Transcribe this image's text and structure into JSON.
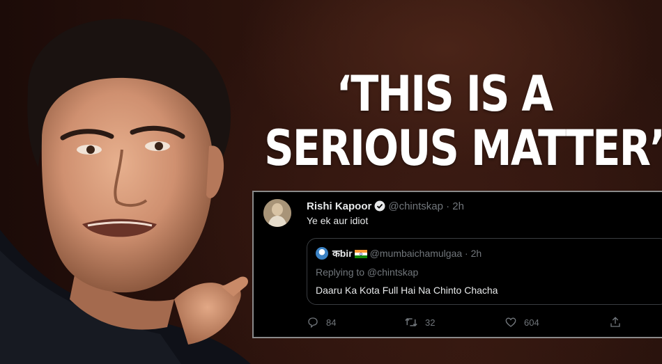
{
  "headline": {
    "line1": "‘THIS IS A",
    "line2": "SERIOUS MATTER’"
  },
  "tweet": {
    "author_name": "Rishi Kapoor",
    "author_handle": "@chintskap",
    "separator": "·",
    "time": "2h",
    "text": "Ye ek aur idiot",
    "quote": {
      "author_name": "कbir",
      "author_handle": "@mumbaichamulgaa",
      "separator": "·",
      "time": "2h",
      "replying_to": "Replying to @chintskap",
      "text": "Daaru Ka Kota Full Hai Na Chinto Chacha"
    },
    "stats": {
      "replies": "84",
      "retweets": "32",
      "likes": "604"
    }
  },
  "icons": {
    "verified": "verified-badge-icon",
    "reply": "reply-icon",
    "retweet": "retweet-icon",
    "like": "heart-icon",
    "share": "share-icon",
    "flag": "india-flag-icon"
  },
  "colors": {
    "headline": "#ffffff",
    "tweet_bg": "#000000",
    "muted": "#71767b"
  }
}
